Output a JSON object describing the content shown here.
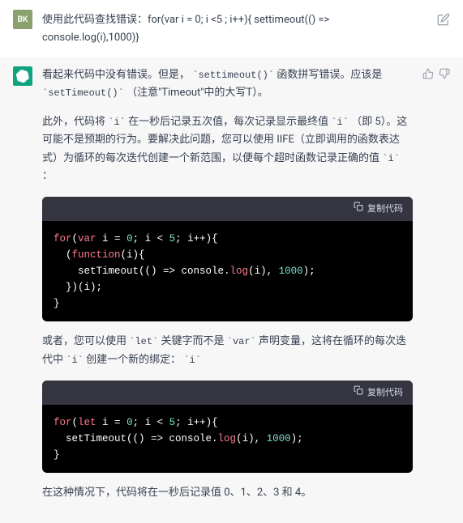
{
  "user": {
    "avatar_text": "BK",
    "message": "使用此代码查找错误：for(var i = 0; i <5 ; i++){ settimeout(() => console.log(i),1000)}"
  },
  "assistant": {
    "para1_prefix": "看起来代码中没有错误。但是，",
    "para1_code1": "`settimeout()`",
    "para1_mid": "函数拼写错误。应该是",
    "para1_code2": "`setTimeout()`",
    "para1_suffix": "（注意\"Timeout\"中的大写T）。",
    "para2_a": "此外，代码将",
    "para2_b": "`i`",
    "para2_c": "在一秒后记录五次值，每次记录显示最终值",
    "para2_d": "`i`",
    "para2_e": "（即 5）。这可能不是预期的行为。要解决此问题，您可以使用 IIFE（立即调用的函数表达式）为循环的每次迭代创建一个新范围，以便每个超时函数记录正确的值",
    "para2_f": "`i`",
    "para2_g": "：",
    "copy_label": "复制代码",
    "code1": {
      "l1_a": "for",
      "l1_b": "(",
      "l1_c": "var",
      "l1_d": " i = ",
      "l1_e": "0",
      "l1_f": "; i < ",
      "l1_g": "5",
      "l1_h": "; i++){",
      "l2_a": "  (",
      "l2_b": "function",
      "l2_c": "(i){",
      "l3_a": "    setTimeout(() => console.",
      "l3_b": "log",
      "l3_c": "(i), ",
      "l3_d": "1000",
      "l3_e": ");",
      "l4": "  })(i);",
      "l5": "}"
    },
    "para3_a": "或者，您可以使用",
    "para3_b": "`let`",
    "para3_c": "关键字而不是",
    "para3_d": "`var`",
    "para3_e": "声明变量，这将在循环的每次迭代中",
    "para3_f": "`i`",
    "para3_g": "创建一个新的绑定：",
    "para3_h": "`i`",
    "code2": {
      "l1_a": "for",
      "l1_b": "(",
      "l1_c": "let",
      "l1_d": " i = ",
      "l1_e": "0",
      "l1_f": "; i < ",
      "l1_g": "5",
      "l1_h": "; i++){",
      "l2_a": "  setTimeout(() => console.",
      "l2_b": "log",
      "l2_c": "(i), ",
      "l2_d": "1000",
      "l2_e": ");",
      "l3": "}"
    },
    "para4": "在这种情况下，代码将在一秒后记录值 0、1、2、3 和 4。"
  }
}
